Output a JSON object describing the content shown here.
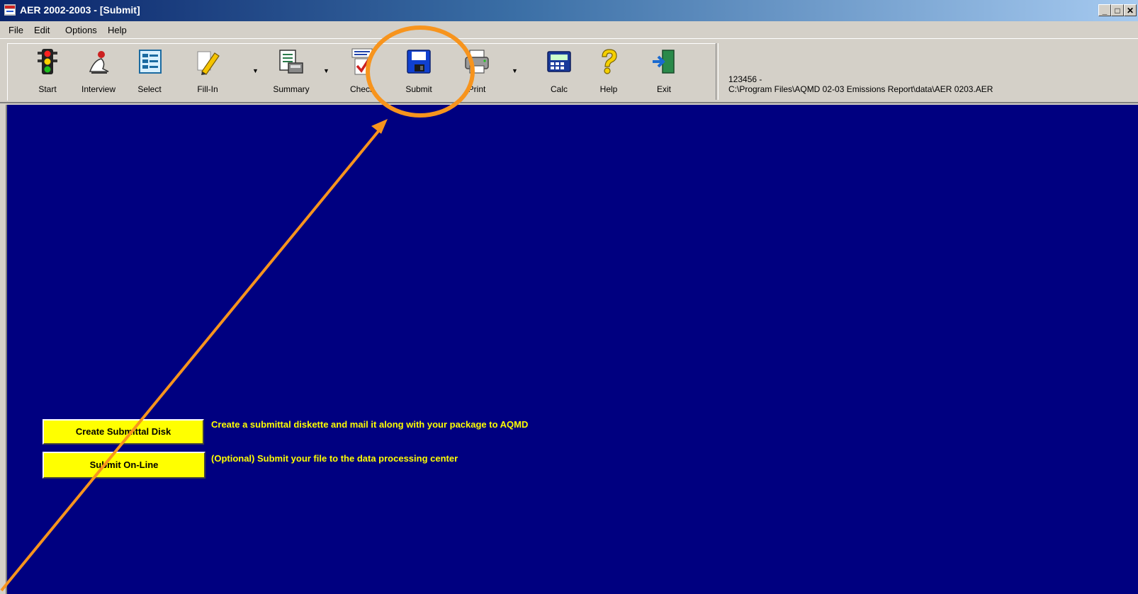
{
  "window": {
    "title": "AER 2002-2003 - [Submit]",
    "controls": {
      "minimize": "_",
      "restore": "□",
      "close": "✕"
    }
  },
  "menu": {
    "items": [
      "File",
      "Edit",
      "Options",
      "Help"
    ]
  },
  "toolbar": {
    "buttons": [
      {
        "label": "Start",
        "icon": "traffic-light-icon"
      },
      {
        "label": "Interview",
        "icon": "interview-icon"
      },
      {
        "label": "Select",
        "icon": "select-list-icon"
      },
      {
        "label": "Fill-In",
        "icon": "pencil-icon"
      },
      {
        "label": "Summary",
        "icon": "summary-icon"
      },
      {
        "label": "Check",
        "icon": "error-check-icon"
      },
      {
        "label": "Submit",
        "icon": "floppy-disk-icon"
      },
      {
        "label": "Print",
        "icon": "printer-icon"
      },
      {
        "label": "Calc",
        "icon": "calculator-icon"
      },
      {
        "label": "Help",
        "icon": "question-mark-icon"
      },
      {
        "label": "Exit",
        "icon": "exit-door-icon"
      }
    ],
    "file_id": "123456 -",
    "file_path": "C:\\Program Files\\AQMD 02-03 Emissions Report\\data\\AER 0203.AER"
  },
  "submit_panel": {
    "create_disk_button": "Create Submittal Disk",
    "create_disk_desc": "Create a submittal diskette and mail it along with your package to AQMD",
    "online_button": "Submit On-Line",
    "online_desc": "(Optional) Submit your file to the data processing center"
  },
  "colors": {
    "content_background": "#000080",
    "button_yellow": "#ffff00",
    "annotation_orange": "#f7941d"
  }
}
